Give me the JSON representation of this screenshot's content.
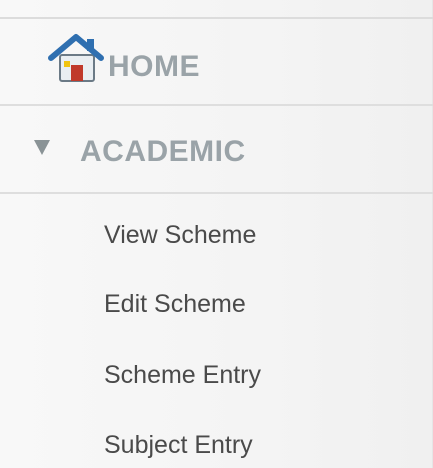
{
  "nav": {
    "home": {
      "label": "HOME",
      "icon": "home-icon"
    },
    "academic": {
      "label": "ACADEMIC",
      "icon": "expand-triangle-icon",
      "expanded": true,
      "items": [
        {
          "label": "View Scheme"
        },
        {
          "label": "Edit Scheme"
        },
        {
          "label": "Scheme Entry"
        },
        {
          "label": "Subject Entry"
        }
      ]
    }
  },
  "colors": {
    "section_label": "#9aa3a8",
    "sub_item": "#4a4a4a",
    "divider": "#dedede",
    "home_icon_blue": "#2f6fb0"
  }
}
